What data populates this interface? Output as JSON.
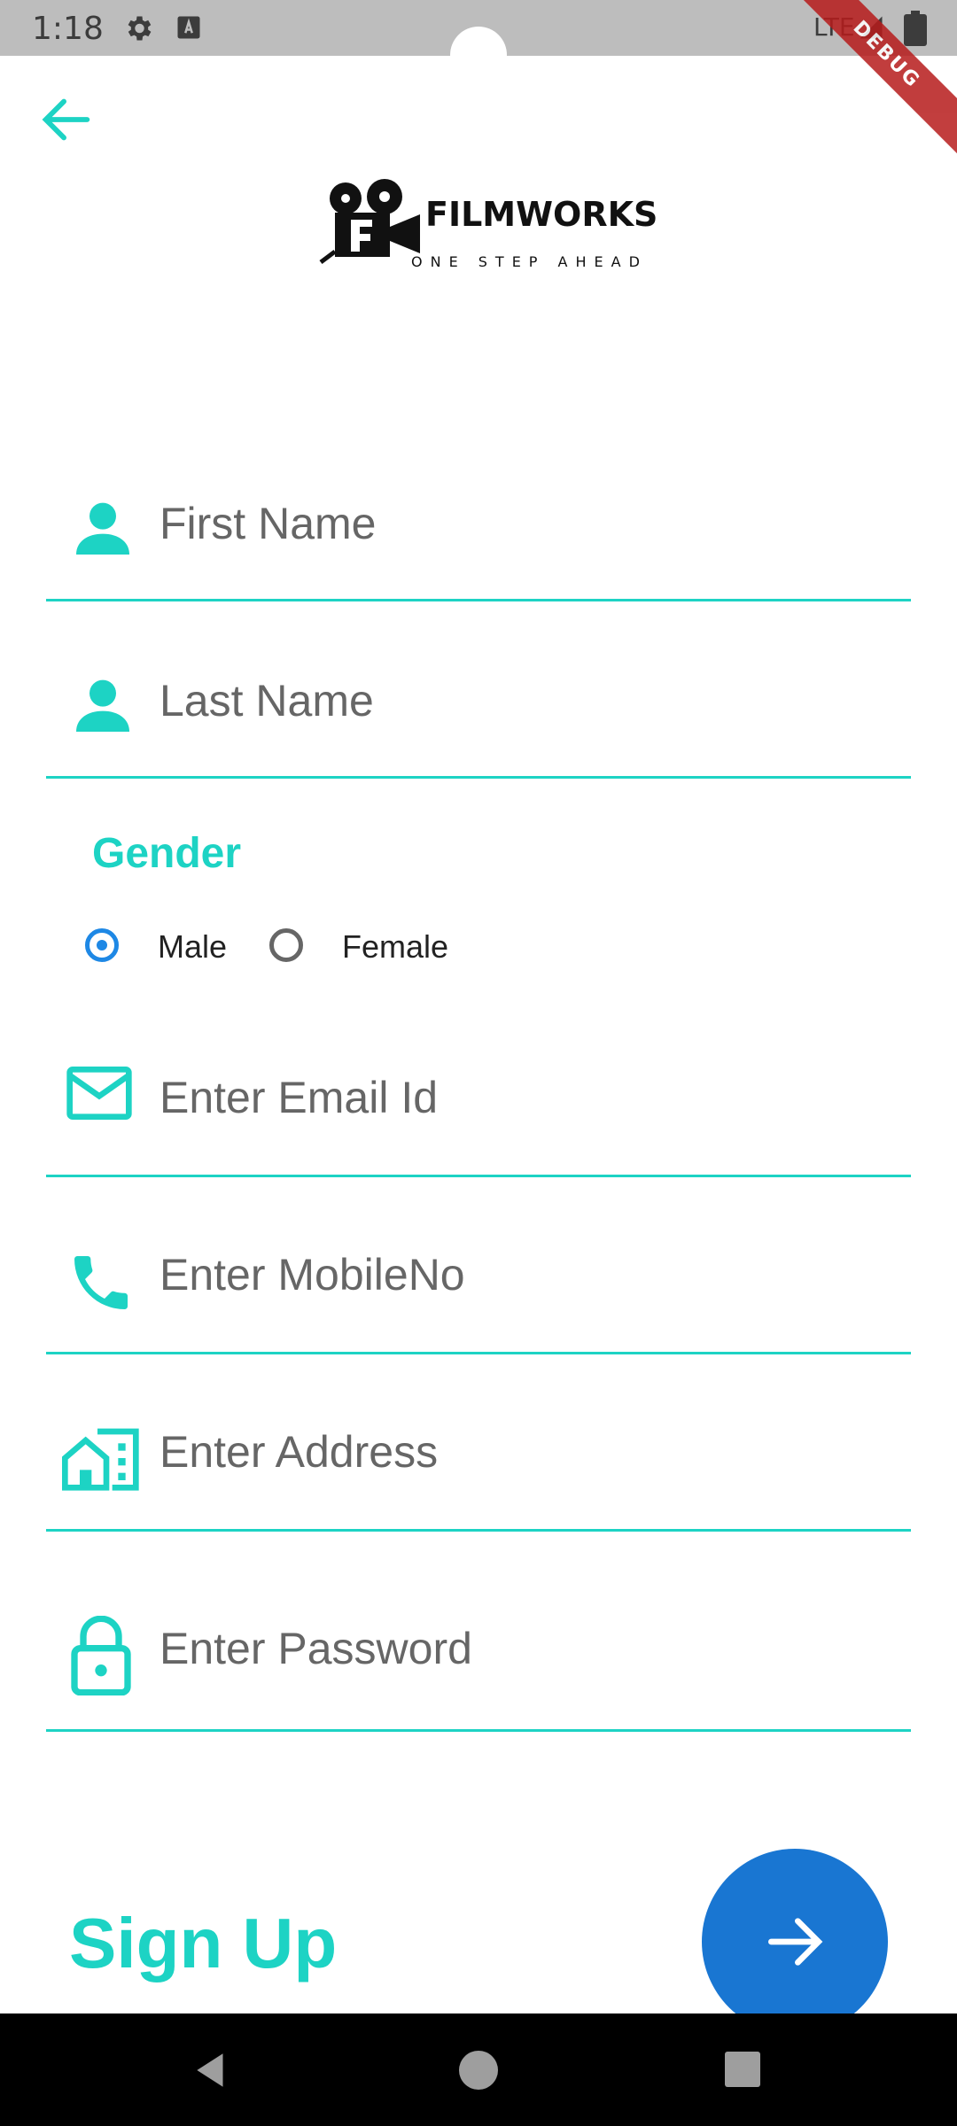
{
  "status_bar": {
    "time": "1:18",
    "network": "LTE"
  },
  "debug_label": "DEBUG",
  "logo": {
    "title": "FILMWORKS",
    "tagline": "ONE STEP AHEAD"
  },
  "form": {
    "first_name_placeholder": "First Name",
    "last_name_placeholder": "Last Name",
    "gender_label": "Gender",
    "gender_options": [
      {
        "label": "Male",
        "selected": true
      },
      {
        "label": "Female",
        "selected": false
      }
    ],
    "email_placeholder": "Enter Email Id",
    "mobile_placeholder": "Enter MobileNo",
    "address_placeholder": "Enter Address",
    "password_placeholder": "Enter Password"
  },
  "footer": {
    "signup_label": "Sign Up"
  },
  "colors": {
    "accent": "#1dd3c4",
    "primary": "#1976d2",
    "hint": "#666666"
  },
  "icons": [
    "back-arrow-icon",
    "person-icon",
    "mail-icon",
    "phone-icon",
    "home-work-icon",
    "lock-icon",
    "arrow-forward-icon",
    "settings-icon",
    "keyboard-icon",
    "signal-icon",
    "battery-icon"
  ]
}
